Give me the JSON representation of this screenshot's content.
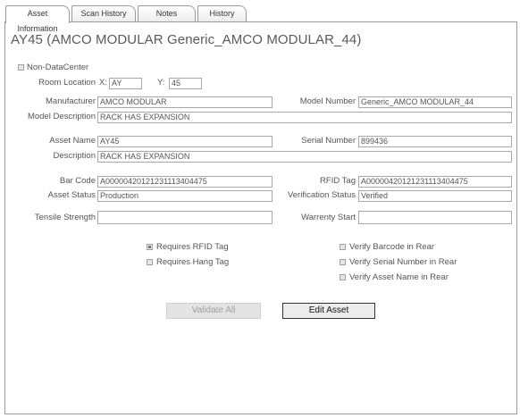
{
  "tabs": [
    {
      "label": "Asset Information",
      "active": true
    },
    {
      "label": "Scan History",
      "active": false
    },
    {
      "label": "Notes",
      "active": false
    },
    {
      "label": "History",
      "active": false
    }
  ],
  "page_title": "AY45 (AMCO MODULAR Generic_AMCO MODULAR_44)",
  "non_datacenter": {
    "label": "Non-DataCenter",
    "checked": false
  },
  "room_location": {
    "label": "Room Location",
    "x_label": "X:",
    "x_value": "AY",
    "y_label": "Y:",
    "y_value": "45"
  },
  "fields": {
    "manufacturer": {
      "label": "Manufacturer",
      "value": "AMCO MODULAR"
    },
    "model_number": {
      "label": "Model Number",
      "value": "Generic_AMCO MODULAR_44"
    },
    "model_description": {
      "label": "Model Description",
      "value": "RACK HAS EXPANSION"
    },
    "asset_name": {
      "label": "Asset Name",
      "value": "AY45"
    },
    "serial_number": {
      "label": "Serial Number",
      "value": "899436"
    },
    "description": {
      "label": "Description",
      "value": "RACK HAS EXPANSION"
    },
    "bar_code": {
      "label": "Bar Code",
      "value": "A0000042012123111340447​5"
    },
    "rfid_tag": {
      "label": "RFID Tag",
      "value": "A00000420121231113404475"
    },
    "asset_status": {
      "label": "Asset Status",
      "value": "Production"
    },
    "verification_status": {
      "label": "Verification Status",
      "value": "Verified"
    },
    "tensile_strength": {
      "label": "Tensile Strength",
      "value": ""
    },
    "warrenty_start": {
      "label": "Warrenty Start",
      "value": ""
    }
  },
  "checkboxes": {
    "requires_rfid": {
      "label": "Requires RFID Tag",
      "checked": true
    },
    "requires_hang": {
      "label": "Requires Hang Tag",
      "checked": false
    },
    "verify_barcode": {
      "label": "Verify Barcode in Rear",
      "checked": false
    },
    "verify_serial": {
      "label": "Verify Serial Number in Rear",
      "checked": false
    },
    "verify_asset_name": {
      "label": "Verify Asset Name in Rear",
      "checked": false
    }
  },
  "buttons": {
    "validate_all": "Validate All",
    "edit_asset": "Edit Asset"
  }
}
